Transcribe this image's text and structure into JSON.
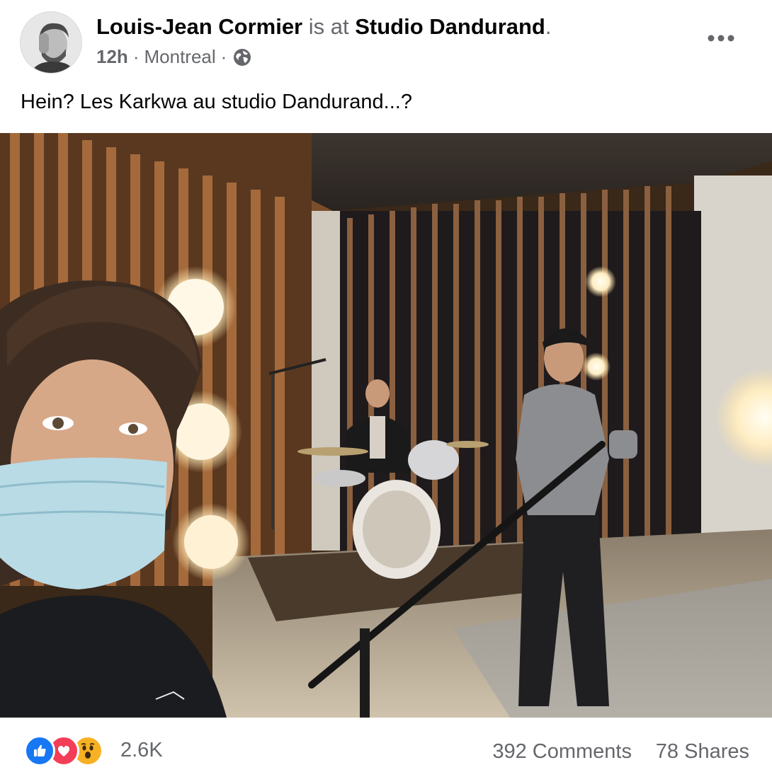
{
  "post": {
    "author": "Louis-Jean Cormier",
    "connector": " is at ",
    "place": "Studio Dandurand",
    "period": ".",
    "time": "12h",
    "location": "Montreal",
    "separator": "·",
    "text": "Hein? Les Karkwa au studio Dandurand...?"
  },
  "icons": {
    "more": "more-options-icon",
    "audience": "globe-icon",
    "reactions": [
      "like-icon",
      "love-icon",
      "wow-icon"
    ]
  },
  "footer": {
    "reaction_count": "2.6K",
    "comments": "392 Comments",
    "shares": "78 Shares"
  },
  "colors": {
    "like": "#1877f2",
    "love": "#f33e58",
    "wow": "#f7b125",
    "secondary_text": "#65676b"
  }
}
